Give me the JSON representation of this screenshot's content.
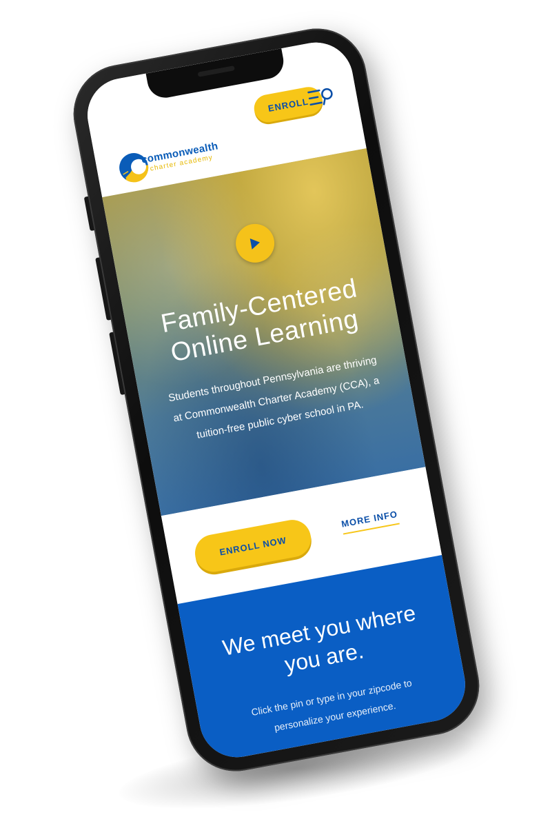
{
  "header": {
    "logo_name": "commonwealth",
    "logo_sub": "charter academy",
    "enroll_label": "ENROLL",
    "menu_icon": "menu-icon",
    "search_icon": "search-icon"
  },
  "hero": {
    "play_icon": "play-icon",
    "title_line1": "Family-Centered",
    "title_line2": "Online Learning",
    "text_line1": "Students throughout Pennsylvania are thriving",
    "text_line2": "at Commonwealth Charter Academy (CCA), a",
    "text_line3": "tuition-free public cyber school in PA."
  },
  "cta": {
    "enroll_now_label": "ENROLL NOW",
    "more_info_label": "MORE INFO"
  },
  "location": {
    "title_line1": "We meet you where",
    "title_line2": "you are.",
    "text_line1": "Click the pin or type in your zipcode to",
    "text_line2": "personalize your experience."
  },
  "colors": {
    "brand_blue": "#0a5ec4",
    "brand_yellow": "#f7c618",
    "text_blue": "#0b4fa8"
  }
}
